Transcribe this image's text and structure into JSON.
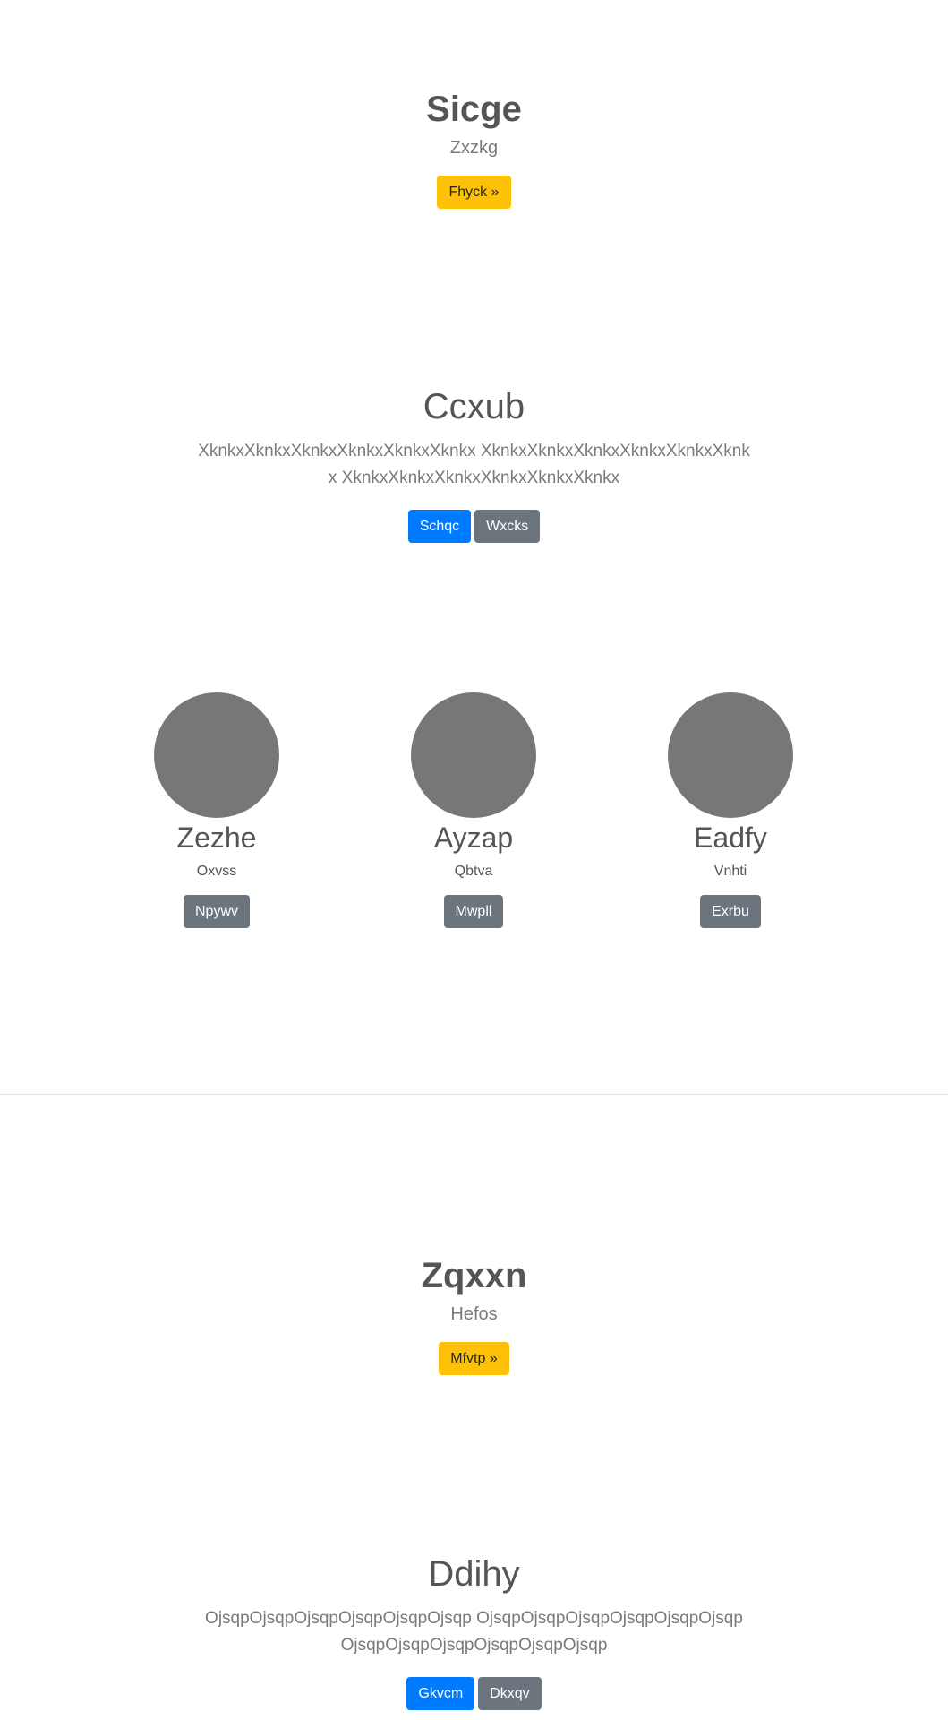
{
  "hero1": {
    "title": "Sicge",
    "subtitle": "Zxzkg",
    "button": "Fhyck »"
  },
  "lead1": {
    "title": "Ccxub",
    "text": "XknkxXknkxXknkxXknkxXknkxXknkx XknkxXknkxXknkxXknkxXknkxXknkx XknkxXknkxXknkxXknkxXknkxXknkx",
    "primary_button": "Schqc",
    "secondary_button": "Wxcks"
  },
  "cards": [
    {
      "title": "Zezhe",
      "text": "Oxvss",
      "button": "Npywv"
    },
    {
      "title": "Ayzap",
      "text": "Qbtva",
      "button": "Mwpll"
    },
    {
      "title": "Eadfy",
      "text": "Vnhti",
      "button": "Exrbu"
    }
  ],
  "hero2": {
    "title": "Zqxxn",
    "subtitle": "Hefos",
    "button": "Mfvtp »"
  },
  "lead2": {
    "title": "Ddihy",
    "text": "OjsqpOjsqpOjsqpOjsqpOjsqpOjsqp OjsqpOjsqpOjsqpOjsqpOjsqpOjsqp OjsqpOjsqpOjsqpOjsqpOjsqpOjsqp",
    "primary_button": "Gkvcm",
    "secondary_button": "Dkxqv"
  },
  "colors": {
    "warning": "#ffc107",
    "primary": "#007bff",
    "secondary": "#6c757d",
    "avatar": "#777777"
  }
}
